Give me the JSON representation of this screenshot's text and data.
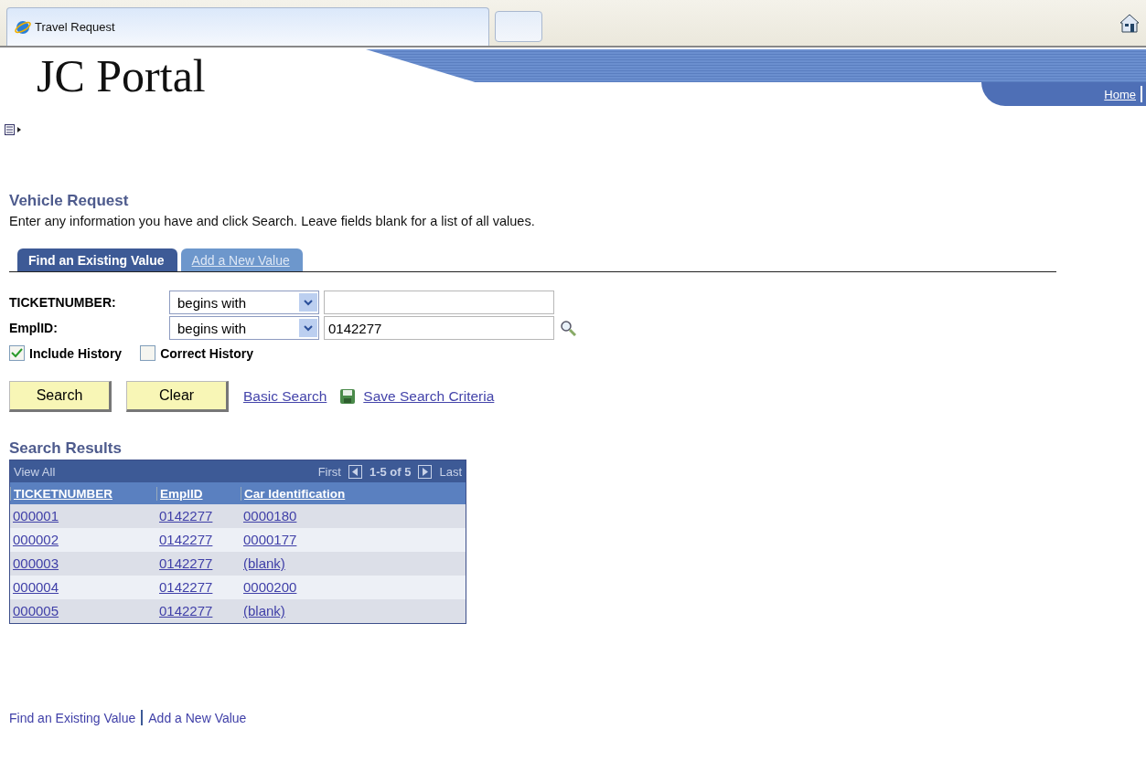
{
  "browser_tab": {
    "title": "Travel Request"
  },
  "header": {
    "logo": "JC Portal",
    "links": [
      "Home"
    ]
  },
  "page": {
    "title": "Vehicle Request",
    "instructions": "Enter any information you have and click Search. Leave fields blank for a list of all values."
  },
  "tabs": [
    {
      "label": "Find an Existing Value",
      "selected": true
    },
    {
      "label": "Add a New Value",
      "selected": false
    }
  ],
  "criteria": [
    {
      "label": "TICKETNUMBER:",
      "operator": "begins with",
      "lookup": false
    },
    {
      "label": "EmplID:",
      "operator": "begins with",
      "value": "0142277",
      "lookup": true
    }
  ],
  "options": [
    {
      "label": "Include History",
      "checked": true
    },
    {
      "label": "Correct History",
      "checked": false
    }
  ],
  "buttons": [
    "Search",
    "Clear"
  ],
  "links": [
    {
      "label": "Basic Search",
      "icon": false
    },
    {
      "label": "Save Search Criteria",
      "icon": true
    }
  ],
  "results": {
    "title": "Search Results",
    "view_all": "View All",
    "first": "First",
    "range": "1-5 of 5",
    "last": "Last",
    "columns": [
      "TICKETNUMBER",
      "EmplID",
      "Car Identification"
    ],
    "rows": [
      [
        "000001",
        "0142277",
        "0000180"
      ],
      [
        "000002",
        "0142277",
        "0000177"
      ],
      [
        "000003",
        "0142277",
        "(blank)"
      ],
      [
        "000004",
        "0142277",
        "0000200"
      ],
      [
        "000005",
        "0142277",
        "(blank)"
      ]
    ]
  },
  "footer_links": [
    "Find an Existing Value",
    "Add a New Value"
  ]
}
